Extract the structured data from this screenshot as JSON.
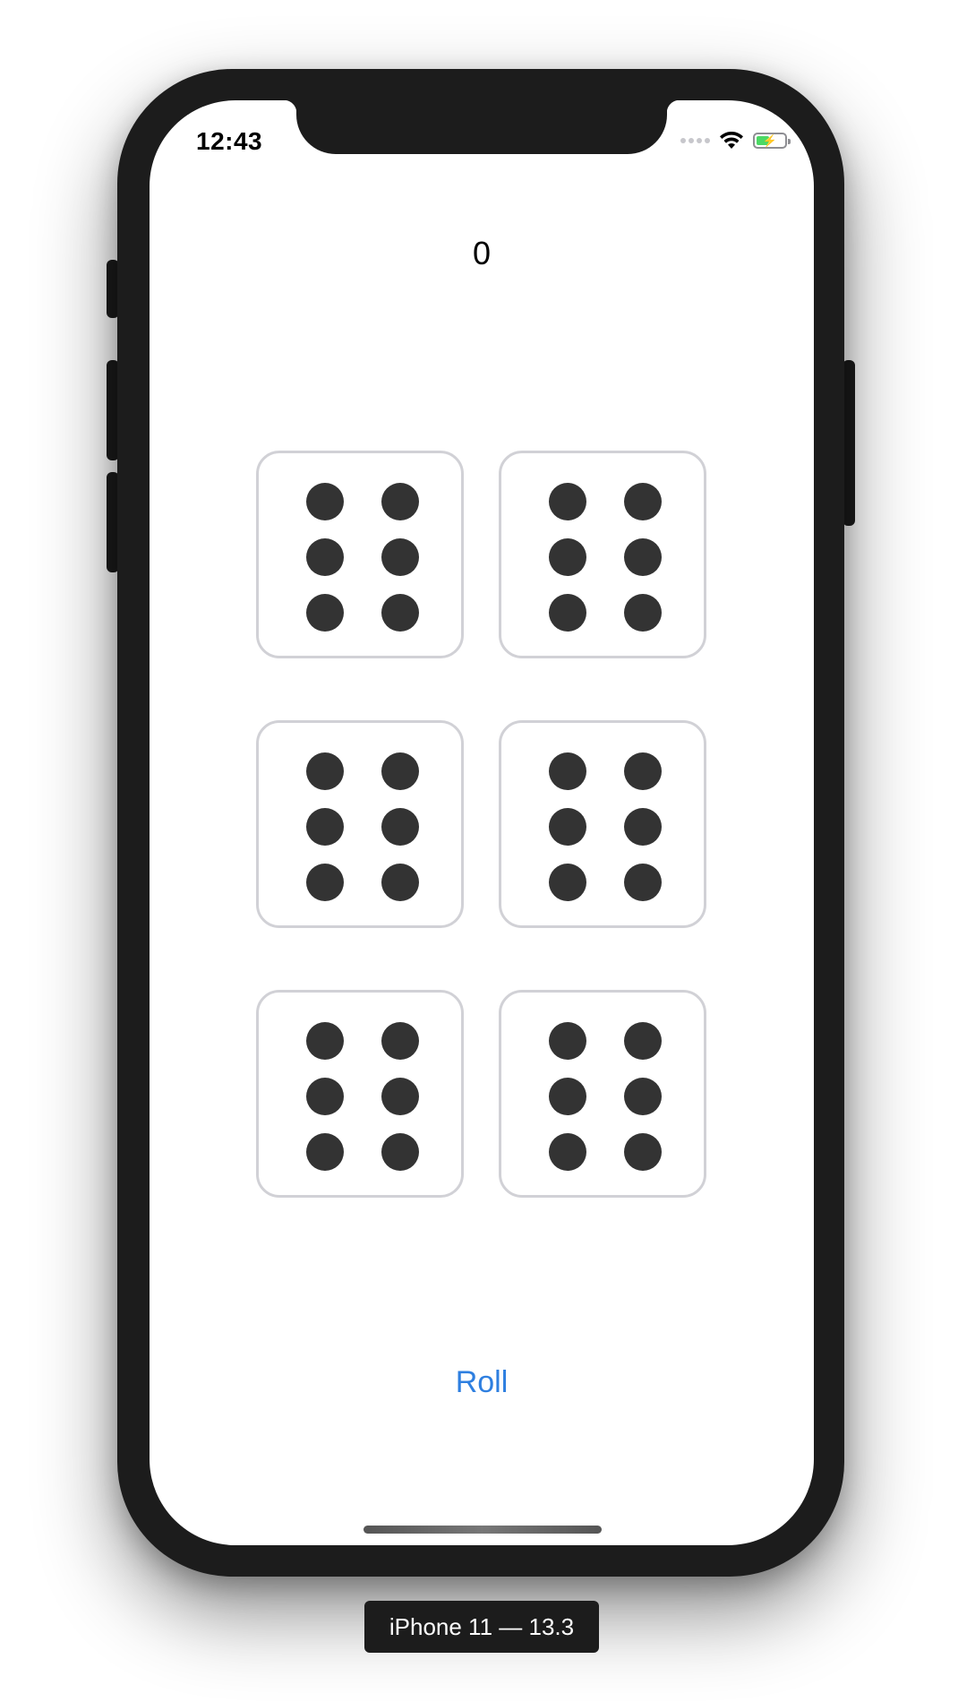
{
  "status_bar": {
    "time": "12:43",
    "battery_color": "#4cd964",
    "battery_level": 0.45,
    "icons": [
      "cellular-signal-icon",
      "wifi-icon",
      "battery-charging-icon"
    ]
  },
  "app": {
    "score": "0",
    "roll_label": "Roll",
    "accent_color": "#2e7fe0",
    "dice": [
      {
        "value": 6
      },
      {
        "value": 6
      },
      {
        "value": 6
      },
      {
        "value": 6
      },
      {
        "value": 6
      },
      {
        "value": 6
      }
    ]
  },
  "simulator": {
    "device_label": "iPhone 11 — 13.3"
  }
}
